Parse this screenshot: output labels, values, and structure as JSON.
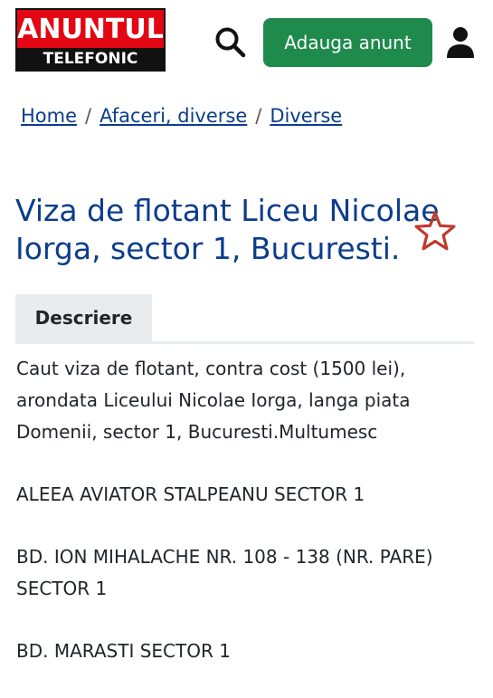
{
  "header": {
    "logo_top": "ANUNTUL",
    "logo_bottom": "TELEFONIC",
    "add_button_label": "Adauga anunt",
    "search_icon": "search-icon",
    "user_icon": "user-icon",
    "colors": {
      "logo_red": "#e30613",
      "button_green": "#1e8a4c"
    }
  },
  "breadcrumb": {
    "items": [
      "Home",
      "Afaceri, diverse",
      "Diverse"
    ],
    "separator": "/"
  },
  "listing": {
    "title": "Viza de flotant Liceu Nicolae Iorga, sector 1, Bucuresti.",
    "favorite_icon": "star-outline-icon",
    "title_color": "#0b3d8c"
  },
  "tabs": [
    {
      "label": "Descriere",
      "active": true
    }
  ],
  "description": {
    "paragraphs": [
      "Caut viza de flotant, contra cost (1500 lei), arondata Liceului Nicolae Iorga, langa piata Domenii, sector 1, Bucuresti.Multumesc",
      "ALEEA AVIATOR STALPEANU SECTOR 1",
      "BD. ION MIHALACHE NR. 108 - 138 (NR. PARE) SECTOR 1",
      "BD. MARASTI SECTOR 1"
    ]
  }
}
